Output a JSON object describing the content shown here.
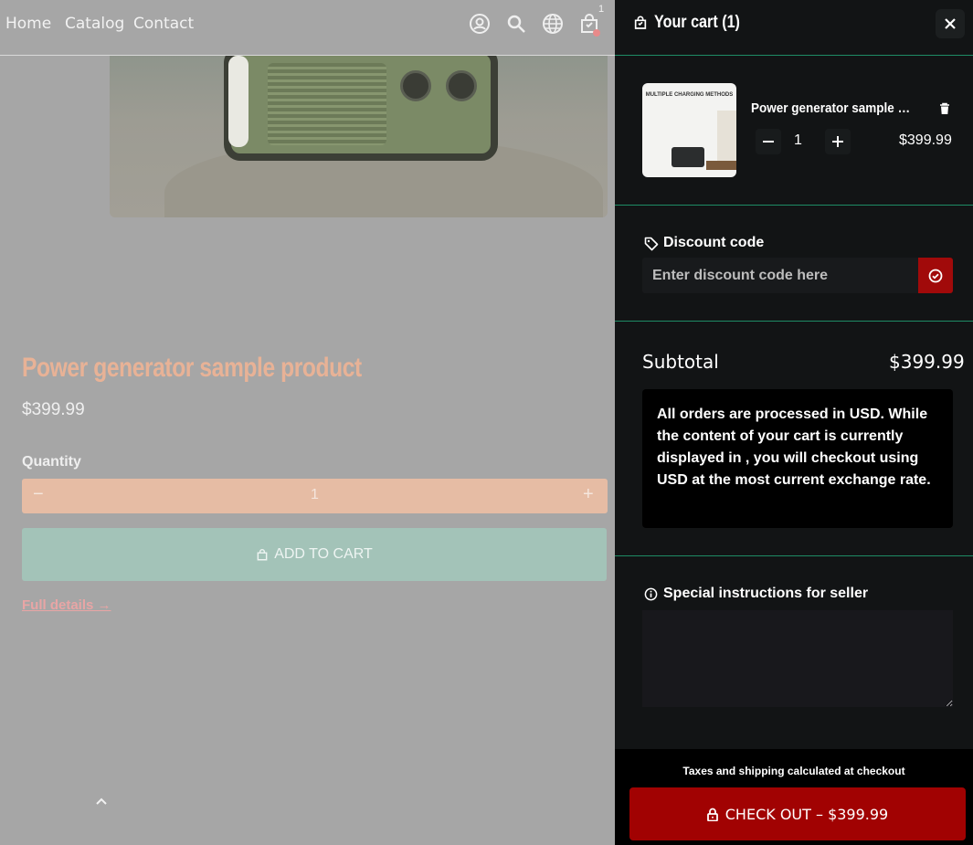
{
  "nav": {
    "links": [
      "Home",
      "Catalog",
      "Contact"
    ],
    "cart_count": "1"
  },
  "product": {
    "title": "Power generator sample product",
    "price": "$399.99",
    "quantity_label": "Quantity",
    "quantity": "1",
    "minus": "−",
    "plus": "+",
    "add_to_cart": "ADD TO CART",
    "full_details": "Full details →"
  },
  "cart": {
    "title": "Your cart (1)",
    "item": {
      "name": "Power generator sample product",
      "quantity": "1",
      "price": "$399.99",
      "image_text": "MULTIPLE CHARGING METHODS"
    },
    "discount": {
      "label": "Discount code",
      "placeholder": "Enter discount code here"
    },
    "subtotal_label": "Subtotal",
    "subtotal_value": "$399.99",
    "currency_note": "All orders are processed in USD. While the content of your cart is currently displayed in , you will checkout using USD at the most current exchange rate.",
    "instructions_label": "Special instructions for seller",
    "tax_note": "Taxes and shipping calculated at checkout",
    "checkout_label": "CHECK OUT – $399.99"
  },
  "colors": {
    "accent_red": "#a10202",
    "separator_green": "#1e8c65",
    "drawer_bg": "#121415"
  }
}
